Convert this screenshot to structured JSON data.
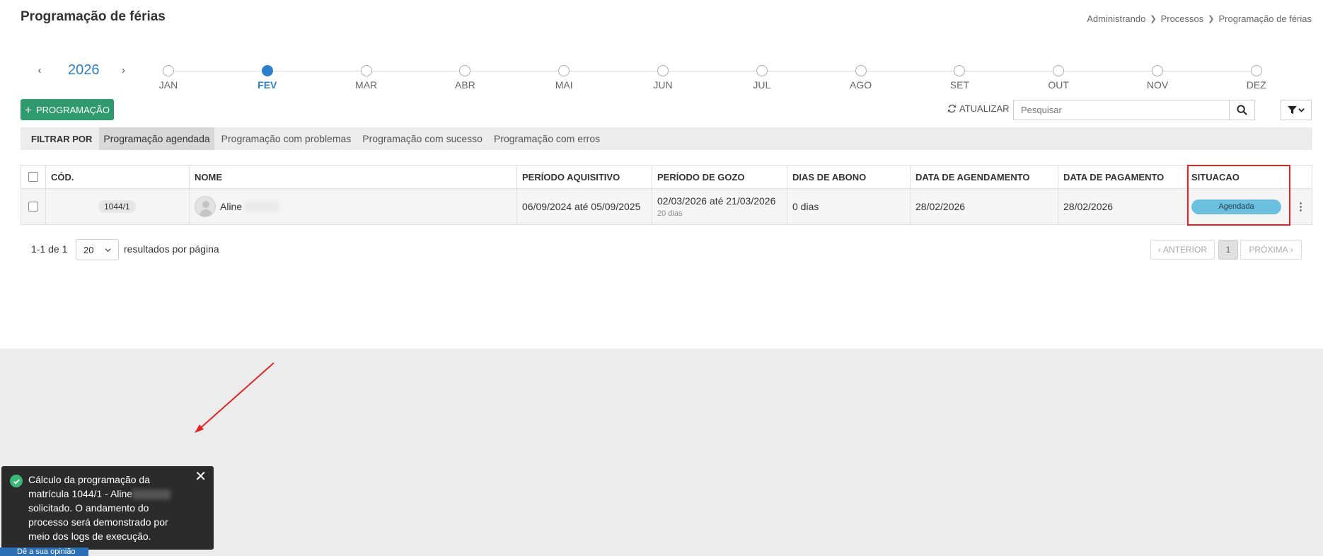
{
  "header": {
    "title": "Programação de férias",
    "breadcrumb": [
      "Administrando",
      "Processos",
      "Programação de férias"
    ]
  },
  "year_selector": {
    "year": "2026"
  },
  "months": [
    {
      "label": "JAN",
      "active": false
    },
    {
      "label": "FEV",
      "active": true
    },
    {
      "label": "MAR",
      "active": false
    },
    {
      "label": "ABR",
      "active": false
    },
    {
      "label": "MAI",
      "active": false
    },
    {
      "label": "JUN",
      "active": false
    },
    {
      "label": "JUL",
      "active": false
    },
    {
      "label": "AGO",
      "active": false
    },
    {
      "label": "SET",
      "active": false
    },
    {
      "label": "OUT",
      "active": false
    },
    {
      "label": "NOV",
      "active": false
    },
    {
      "label": "DEZ",
      "active": false
    }
  ],
  "toolbar": {
    "add_label": "PROGRAMAÇÃO",
    "refresh_label": "ATUALIZAR",
    "search_placeholder": "Pesquisar"
  },
  "filter": {
    "label": "FILTRAR POR",
    "items": [
      {
        "label": "Programação agendada",
        "active": true
      },
      {
        "label": "Programação com problemas",
        "active": false
      },
      {
        "label": "Programação com sucesso",
        "active": false
      },
      {
        "label": "Programação com erros",
        "active": false
      }
    ]
  },
  "table": {
    "headers": [
      "CÓD.",
      "NOME",
      "PERÍODO AQUISITIVO",
      "PERÍODO DE GOZO",
      "DIAS DE ABONO",
      "DATA DE AGENDAMENTO",
      "DATA DE PAGAMENTO",
      "SITUACAO"
    ],
    "rows": [
      {
        "code": "1044/1",
        "name": "Aline",
        "periodo_aquisitivo": "06/09/2024 até 05/09/2025",
        "periodo_gozo": "02/03/2026 até 21/03/2026",
        "gozo_dias": "20 dias",
        "dias_abono": "0 dias",
        "data_agendamento": "28/02/2026",
        "data_pagamento": "28/02/2026",
        "situacao": "Agendada"
      }
    ]
  },
  "pagination": {
    "range": "1-1 de 1",
    "per_page": "20",
    "per_page_label": "resultados por página",
    "prev_label": "ANTERIOR",
    "current_page": "1",
    "next_label": "PRÓXIMA"
  },
  "toast": {
    "line1": "Cálculo da programação da",
    "line2": "matrícula 1044/1 - Aline",
    "line3": "solicitado. O andamento do",
    "line4": "processo será demonstrado por",
    "line5": "meio dos logs de execução."
  },
  "feedback_label": "Dê a sua opinião",
  "colors": {
    "primary_blue": "#2d7fc9",
    "green_button": "#2e9a6e",
    "status_badge": "#6cc0df",
    "highlight_red": "#e02424",
    "toast_bg": "#2b2b2b"
  }
}
